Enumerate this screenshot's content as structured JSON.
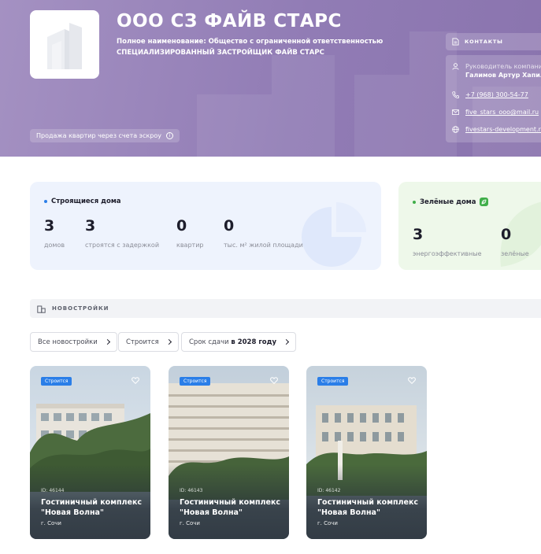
{
  "header": {
    "title": "ООО СЗ ФАЙВ СТАРС",
    "full_name_line1": "Полное наименование: Общество с ограниченной ответственностью",
    "full_name_line2": "СПЕЦИАЛИЗИРОВАННЫЙ ЗАСТРОЙЩИК ФАЙВ СТАРС",
    "escrow_label": "Продажа квартир через счета эскроу",
    "logo_icon": "building-icon"
  },
  "contacts": {
    "heading": "КОНТАКТЫ",
    "manager_label": "Руководитель компании",
    "manager_name": "Галимов Артур Хапилович",
    "phone": "+7 (968) 300-54-77",
    "email": "five_stars_ooo@mail.ru",
    "website": "fivestars-development.ru"
  },
  "stats": {
    "heading": "Строящиеся дома",
    "items": [
      {
        "value": "3",
        "label": "домов"
      },
      {
        "value": "3",
        "label": "строятся с задержкой"
      },
      {
        "value": "0",
        "label": "квартир"
      },
      {
        "value": "0",
        "label": "тыс. м² жилой площади"
      }
    ]
  },
  "green": {
    "heading": "Зелёные дома",
    "items": [
      {
        "value": "3",
        "label": "энергоэффективные"
      },
      {
        "value": "0",
        "label": "зелёные"
      }
    ]
  },
  "newbuilds": {
    "section_title": "НОВОСТРОЙКИ",
    "filters": {
      "all": "Все новостройки",
      "status": "Строится",
      "deadline_prefix": "Срок сдачи",
      "deadline_value": "в 2028 году"
    },
    "cards": [
      {
        "badge": "Строится",
        "id": "ID: 46144",
        "name": "Гостиничный комплекс \"Новая Волна\"",
        "city": "г. Сочи"
      },
      {
        "badge": "Строится",
        "id": "ID: 46143",
        "name": "Гостиничный комплекс \"Новая Волна\"",
        "city": "г. Сочи"
      },
      {
        "badge": "Строится",
        "id": "ID: 46142",
        "name": "Гостиничный комплекс \"Новая Волна\"",
        "city": "г. Сочи"
      }
    ]
  },
  "colors": {
    "header_purple": "#917cb5",
    "badge_blue": "#2a7ee8",
    "green_accent": "#3fae49",
    "stats_bg": "#eef3fd",
    "green_bg": "#eef8ea"
  }
}
